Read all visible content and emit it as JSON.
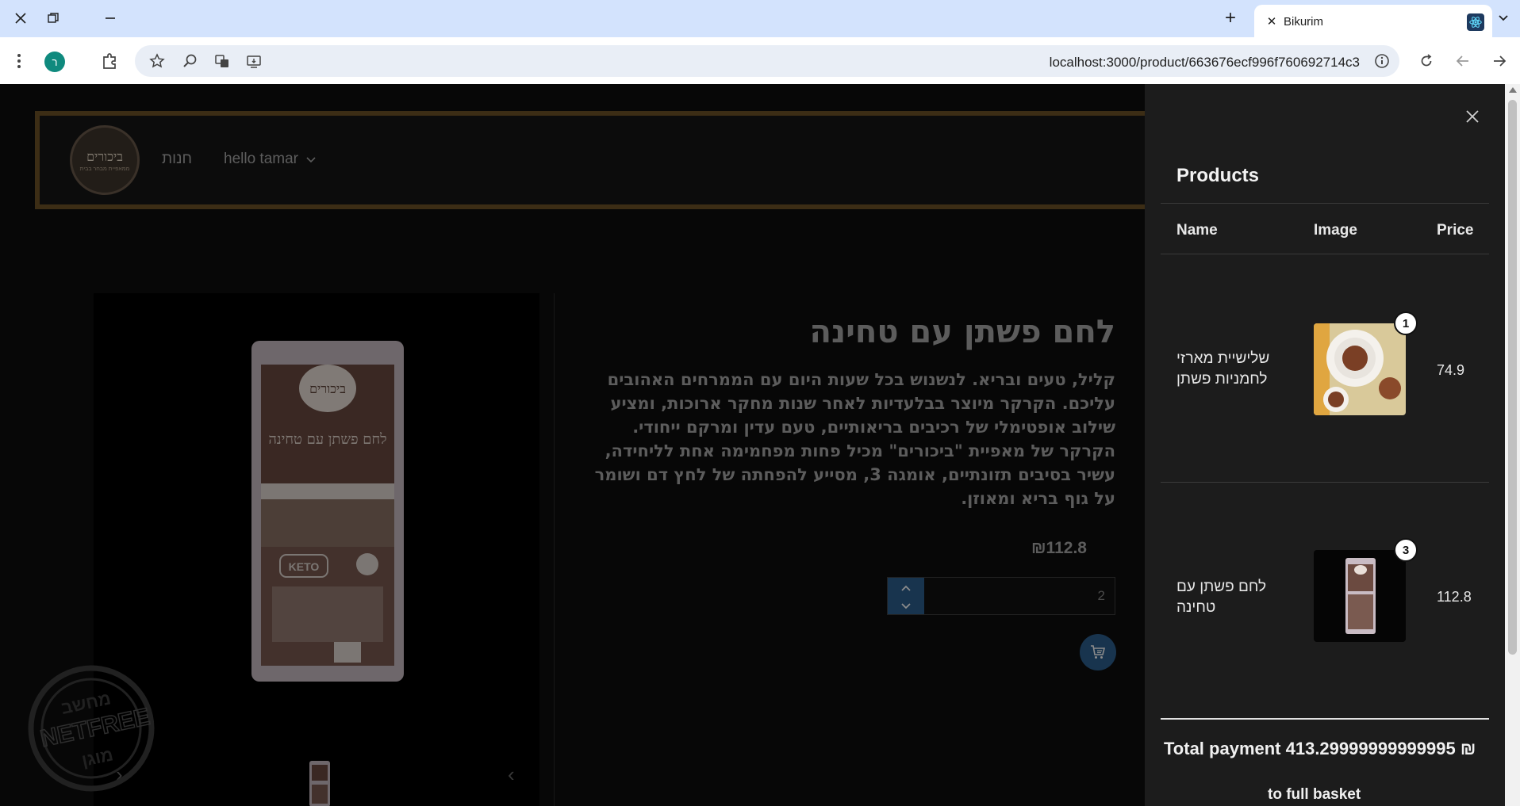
{
  "browser": {
    "tab_title": "Bikurim",
    "url": "localhost:3000/product/663676ecf996f760692714c3",
    "profile_initial": "ר"
  },
  "nav": {
    "logo_text": "ביכורים",
    "logo_sub": "ממאפיית מבחר בבית",
    "shop_link": "חנות",
    "user_greeting": "hello tamar"
  },
  "product": {
    "title": "לחם פשתן עם טחינה",
    "description": "קליל, טעים ובריא. לנשנוש בכל שעות היום עם הממרחים האהובים עליכם. הקרקר מיוצר בבלעדיות לאחר שנות מחקר ארוכות, ומציע שילוב אופטימלי של רכיבים בריאותיים, טעם עדין ומרקם ייחודי. הקרקר של מאפיית \"ביכורים\" מכיל פחות מפחמימה אחת לליחידה, עשיר בסיבים תזונתיים, אומגה 3, מסייע להפחתה של לחץ דם ושומר על גוף בריא ומאוזן.",
    "price": "₪112.8",
    "quantity": "2",
    "package_brand": "ביכורים",
    "package_name": "לחם פשתן עם טחינה",
    "package_badge": "KETO"
  },
  "watermark": {
    "top": "מחשב",
    "middle": "NETFREE",
    "bottom": "מוגן"
  },
  "basket": {
    "heading": "Products",
    "columns": {
      "name": "Name",
      "image": "Image",
      "price": "Price"
    },
    "items": [
      {
        "name": "שלישיית מארזי לחמניות פשתן",
        "quantity": "1",
        "price": "74.9"
      },
      {
        "name": "לחם פשתן עם טחינה",
        "quantity": "3",
        "price": "112.8"
      }
    ],
    "total": "Total payment 413.29999999999995 ₪",
    "full_basket": "to full basket"
  }
}
